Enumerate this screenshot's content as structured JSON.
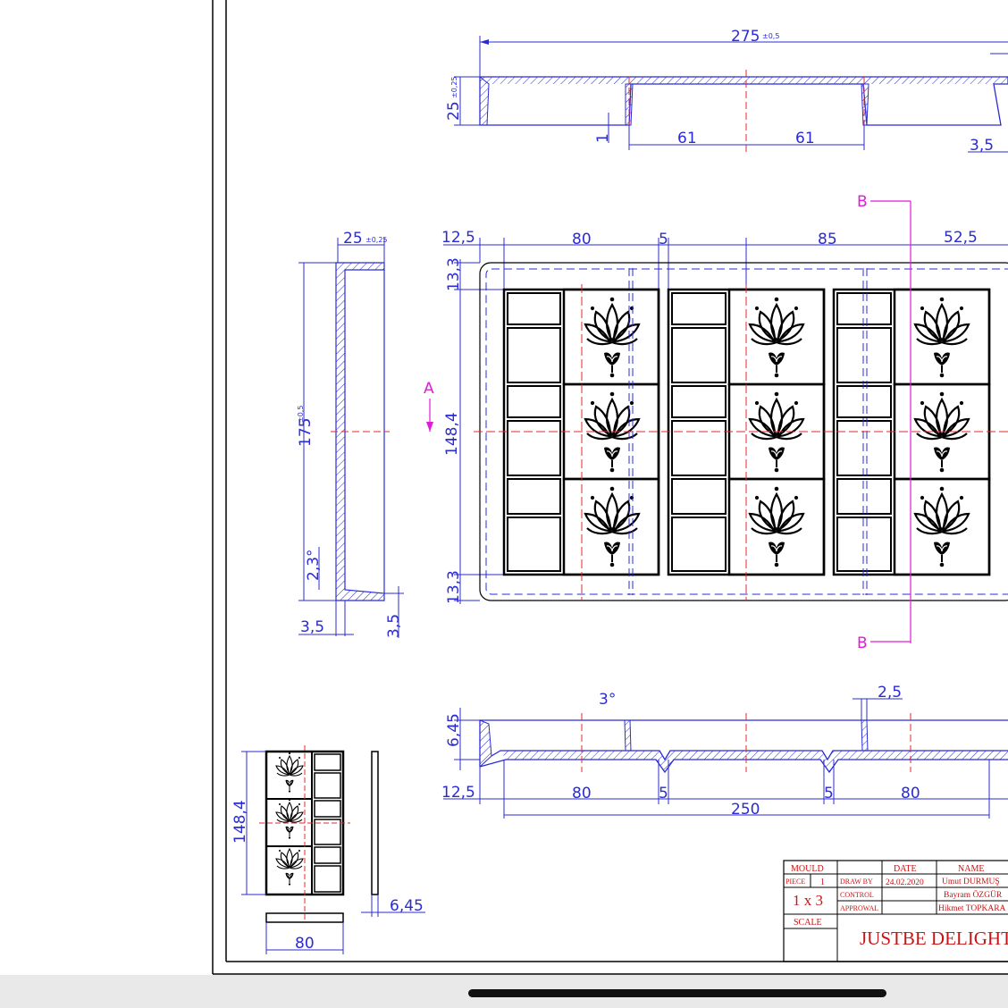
{
  "dimensions": {
    "top_width": "275",
    "top_width_tol": "±0,5",
    "top_height": "25",
    "top_height_tol": "±0,25",
    "top_step": "1",
    "top_61a": "61",
    "top_61b": "61",
    "top_wall": "3,5",
    "side_depth": "25",
    "side_depth_tol": "±0,25",
    "side_length": "175",
    "side_length_tol": "±0,5",
    "side_draft": "2,3°",
    "side_wall_bottom": "3,5",
    "side_wall_right": "3,5",
    "plan_margin": "12,5",
    "plan_80": "80",
    "plan_gap": "5",
    "plan_85": "85",
    "plan_52": "52,5",
    "plan_13_top": "13,3",
    "plan_13_bottom": "13,3",
    "plan_height": "148,4",
    "bottom_draft": "3°",
    "bottom_2_5": "2,5",
    "bottom_depth": "6,45",
    "bottom_12_5": "12,5",
    "bottom_80a": "80",
    "bottom_5a": "5",
    "bottom_5b": "5",
    "bottom_80b": "80",
    "bottom_250": "250",
    "small_height": "148,4",
    "small_thick": "6,45",
    "small_width": "80"
  },
  "section_markers": {
    "a": "A",
    "b_top": "B",
    "b_bottom": "B"
  },
  "title_block": {
    "mould": "MOULD",
    "date_h": "DATE",
    "name_h": "NAME",
    "piece": "PIECE",
    "piece_val": "1",
    "draw_by": "DRAW BY",
    "draw_date": "24.02.2020",
    "draw_name": "Umut DURMUŞ",
    "control": "CONTROL",
    "control_name": "Bayram ÖZGÜR",
    "approval": "APPROWAL",
    "approval_name": "Hikmet TOPKARA",
    "layout": "1 x 3",
    "scale": "SCALE",
    "company": "JUSTBE DELIGHT"
  },
  "colors": {
    "dimension": "#2b2bd6",
    "center_line": "#e0282a",
    "section": "#e01cd8",
    "outline": "#000000"
  },
  "icons": [
    "lotus-icon"
  ]
}
